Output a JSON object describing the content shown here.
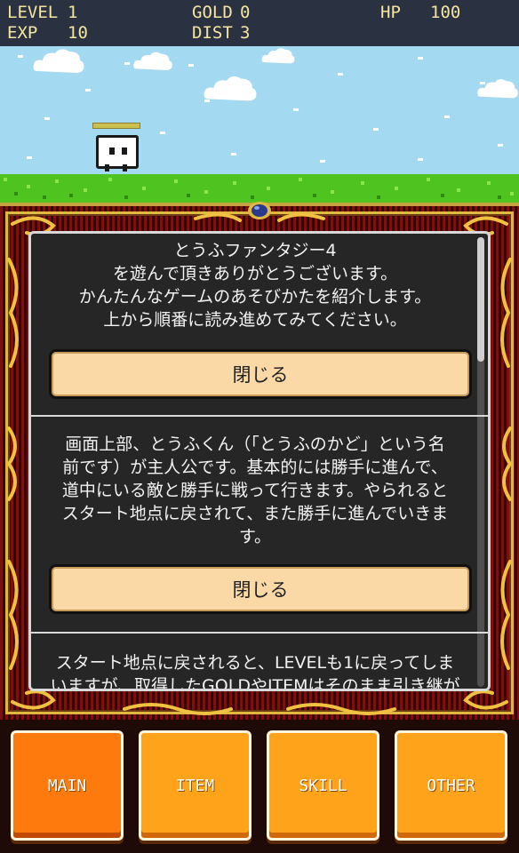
{
  "hud": {
    "level_label": "LEVEL",
    "level_value": "1",
    "exp_label": "EXP",
    "exp_value": "10",
    "gold_label": "GOLD",
    "gold_value": "0",
    "dist_label": "DIST",
    "dist_value": "3",
    "hp_label": "HP",
    "hp_value": "100"
  },
  "colors": {
    "hud_text": "#f4e6a0",
    "sky": "#a4d9f2",
    "grass": "#4fc320",
    "close_button": "#fbd9a6",
    "menu_button": "#ffa31a",
    "menu_button_active": "#ff7a0c"
  },
  "panel": {
    "sections": [
      {
        "lines": [
          "とうふファンタジー4",
          "を遊んで頂きありがとうございます。",
          "かんたんなゲームのあそびかたを紹介します。",
          "上から順番に読み進めてみてください。"
        ],
        "button_label": "閉じる"
      },
      {
        "lines": [
          "画面上部、とうふくん（「とうふのかど」という名",
          "前です）が主人公です。基本的には勝手に進んで、",
          "道中にいる敵と勝手に戦って行きます。やられると",
          "スタート地点に戻されて、また勝手に進んでいきま",
          "す。"
        ],
        "button_label": "閉じる"
      },
      {
        "lines": [
          "スタート地点に戻されると、LEVELも1に戻ってしま",
          "いますが、取得したGOLDやITEMはそのまま引き継が"
        ]
      }
    ]
  },
  "menu": {
    "items": [
      {
        "label": "MAIN",
        "active": true
      },
      {
        "label": "ITEM",
        "active": false
      },
      {
        "label": "SKILL",
        "active": false
      },
      {
        "label": "OTHER",
        "active": false
      }
    ]
  }
}
